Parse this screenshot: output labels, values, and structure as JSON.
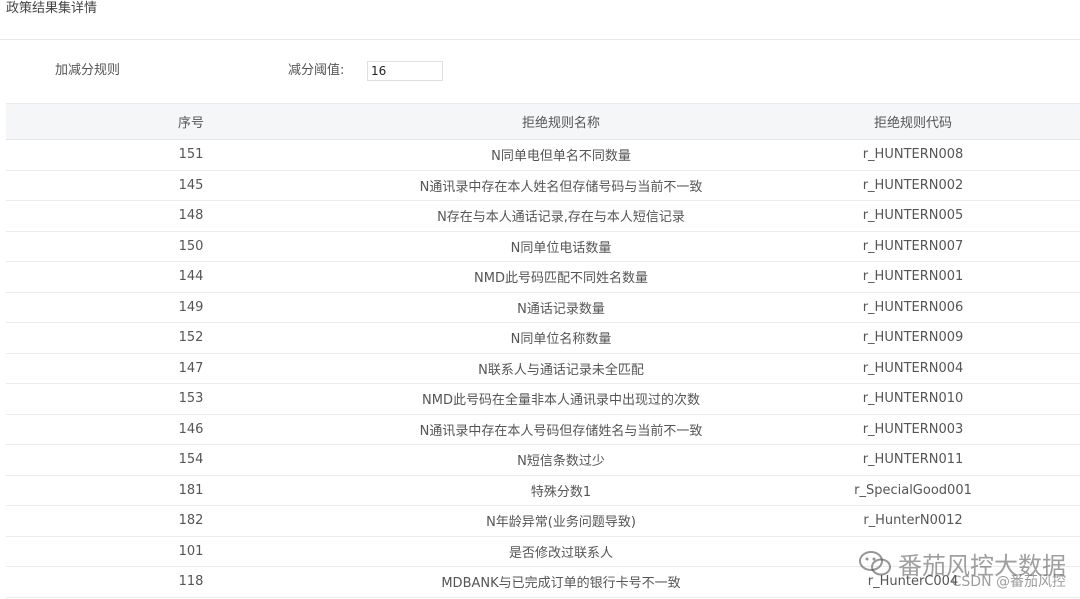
{
  "page_title": "政策结果集详情",
  "rule_label": "加减分规则",
  "threshold": {
    "label": "减分阈值:",
    "value": "16"
  },
  "table": {
    "headers": [
      "序号",
      "拒绝规则名称",
      "拒绝规则代码"
    ],
    "rows": [
      [
        "151",
        "N同单电但单名不同数量",
        "r_HUNTERN008"
      ],
      [
        "145",
        "N通讯录中存在本人姓名但存储号码与当前不一致",
        "r_HUNTERN002"
      ],
      [
        "148",
        "N存在与本人通话记录,存在与本人短信记录",
        "r_HUNTERN005"
      ],
      [
        "150",
        "N同单位电话数量",
        "r_HUNTERN007"
      ],
      [
        "144",
        "NMD此号码匹配不同姓名数量",
        "r_HUNTERN001"
      ],
      [
        "149",
        "N通话记录数量",
        "r_HUNTERN006"
      ],
      [
        "152",
        "N同单位名称数量",
        "r_HUNTERN009"
      ],
      [
        "147",
        "N联系人与通话记录未全匹配",
        "r_HUNTERN004"
      ],
      [
        "153",
        "NMD此号码在全量非本人通讯录中出现过的次数",
        "r_HUNTERN010"
      ],
      [
        "146",
        "N通讯录中存在本人号码但存储姓名与当前不一致",
        "r_HUNTERN003"
      ],
      [
        "154",
        "N短信条数过少",
        "r_HUNTERN011"
      ],
      [
        "181",
        "特殊分数1",
        "r_SpecialGood001"
      ],
      [
        "182",
        "N年龄异常(业务问题导致)",
        "r_HunterN0012"
      ],
      [
        "101",
        "是否修改过联系人",
        ""
      ],
      [
        "118",
        "MDBANK与已完成订单的银行卡号不一致",
        "r_HunterC004"
      ]
    ]
  },
  "watermark": {
    "main": "番茄风控大数据",
    "sub": "CSDN @番茄风控",
    "icon": "wechat-icon"
  }
}
